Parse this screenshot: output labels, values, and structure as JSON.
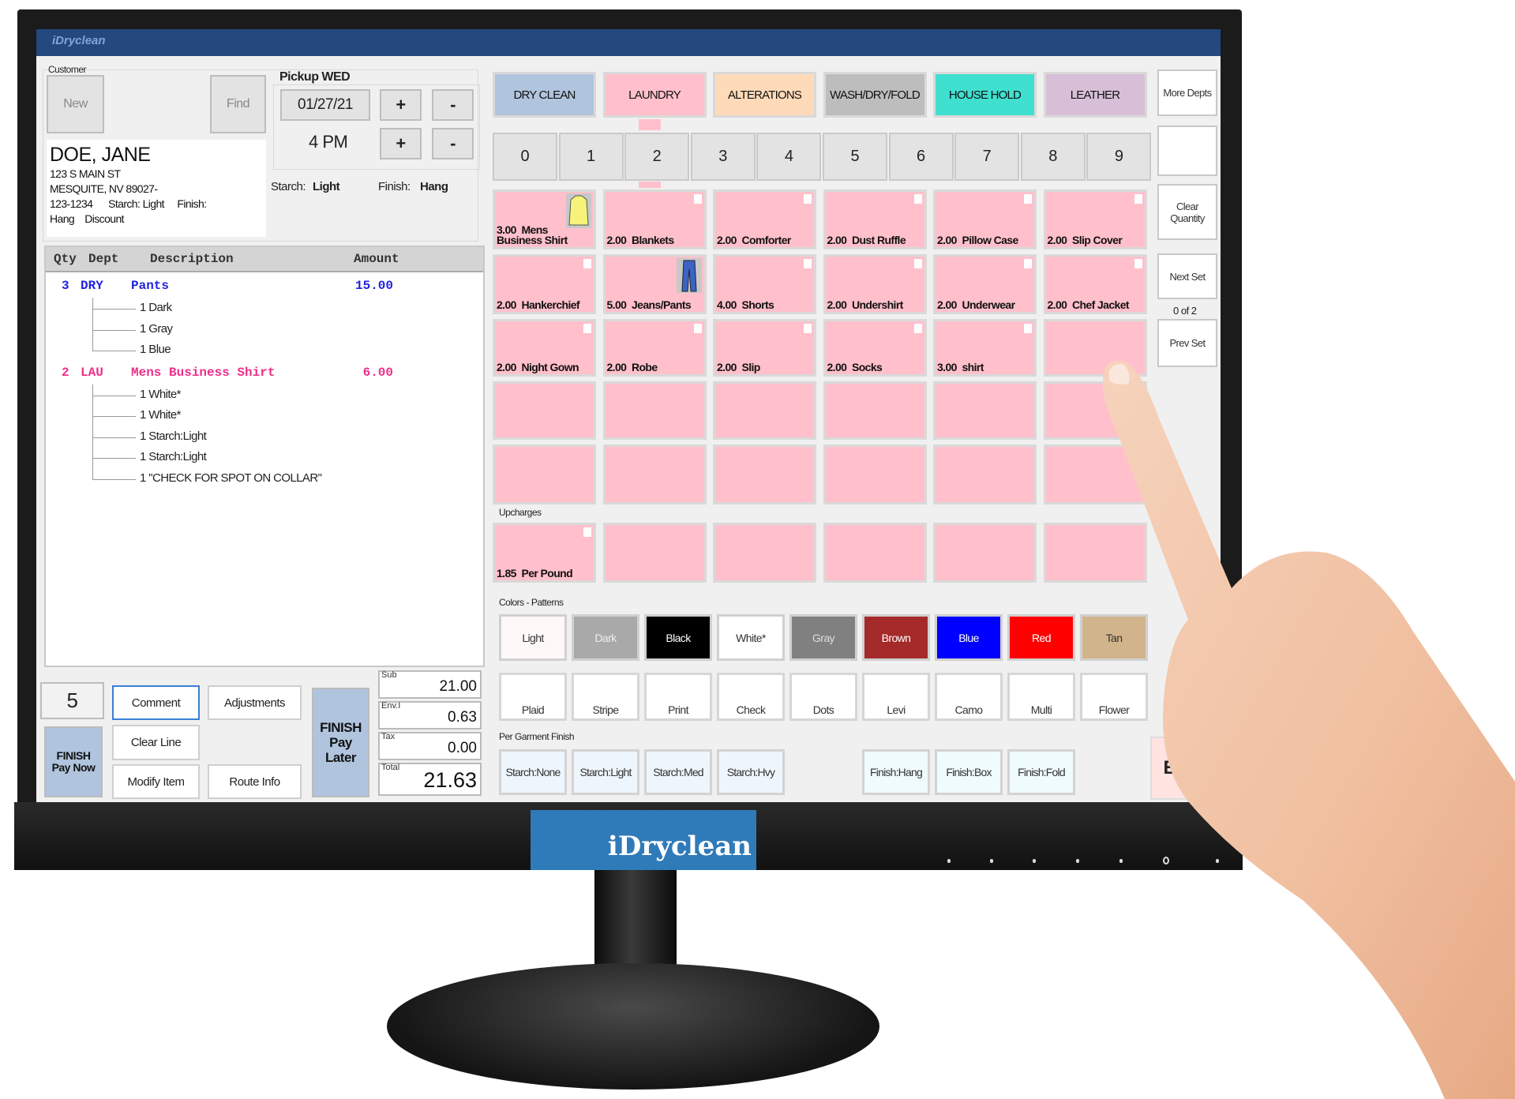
{
  "app": {
    "title_logo": "iDryclean",
    "bezel_logo": "iDryclean"
  },
  "customer": {
    "group_label": "Customer",
    "new_label": "New",
    "find_label": "Find",
    "name": "DOE, JANE",
    "address": "123 S MAIN ST",
    "city": "MESQUITE, NV  89027-",
    "phone": "123-1234",
    "starch": "Starch: Light",
    "finish": "Finish:",
    "finish2": "Hang",
    "discount": "Discount"
  },
  "pickup": {
    "label": "Pickup WED",
    "date": "01/27/21",
    "time": "4 PM",
    "plus": "+",
    "minus": "-",
    "starch_label": "Starch:",
    "starch_value": "Light",
    "finish_label": "Finish:",
    "finish_value": "Hang"
  },
  "grid": {
    "headers": {
      "qty": "Qty",
      "dept": "Dept",
      "desc": "Description",
      "amount": "Amount"
    },
    "rows": [
      {
        "qty": "3",
        "dept": "DRY",
        "desc": "Pants",
        "amount": "15.00",
        "color": "#2222dd",
        "subs": [
          "1 Dark",
          "1 Gray",
          "1 Blue"
        ]
      },
      {
        "qty": "2",
        "dept": "LAU",
        "desc": "Mens Business Shirt",
        "amount": "6.00",
        "color": "#ee2f8a",
        "subs": [
          "1 White*",
          "1 White*",
          "1 Starch:Light",
          "1 Starch:Light",
          "1 \"CHECK FOR SPOT ON COLLAR\""
        ]
      }
    ]
  },
  "actions": {
    "quantity": "5",
    "comment": "Comment",
    "adjustments": "Adjustments",
    "clear_line": "Clear Line",
    "modify_item": "Modify Item",
    "route_info": "Route Info",
    "finish_now": "FINISH\nPay Now",
    "finish_later": "FINISH\nPay\nLater"
  },
  "totals": [
    {
      "label": "Sub",
      "value": "21.00"
    },
    {
      "label": "Env.I",
      "value": "0.63"
    },
    {
      "label": "Tax",
      "value": "0.00"
    },
    {
      "label": "Total",
      "value": "21.63"
    }
  ],
  "departments": [
    {
      "label": "DRY CLEAN",
      "color": "#b0c4de"
    },
    {
      "label": "LAUNDRY",
      "color": "#ffc0cb"
    },
    {
      "label": "ALTERATIONS",
      "color": "#ffdab9"
    },
    {
      "label": "WASH/DRY/FOLD",
      "color": "#bdbdbd"
    },
    {
      "label": "HOUSE HOLD",
      "color": "#40e0d0"
    },
    {
      "label": "LEATHER",
      "color": "#d8bfd8"
    }
  ],
  "selected_department": "LAUNDRY",
  "numbers": [
    "0",
    "1",
    "2",
    "3",
    "4",
    "5",
    "6",
    "7",
    "8",
    "9"
  ],
  "selected_number": "2",
  "side": {
    "more_depts": "More Depts",
    "clear_quantity": "Clear Quantity",
    "next_set": "Next Set",
    "set_count": "0 of 2",
    "prev_set": "Prev Set"
  },
  "items": [
    {
      "price": "3.00",
      "name": "Mens\nBusiness Shirt",
      "icon": "shirt-icon"
    },
    {
      "price": "2.00",
      "name": "Blankets"
    },
    {
      "price": "2.00",
      "name": "Comforter"
    },
    {
      "price": "2.00",
      "name": "Dust Ruffle"
    },
    {
      "price": "2.00",
      "name": "Pillow Case"
    },
    {
      "price": "2.00",
      "name": "Slip Cover"
    },
    {
      "price": "2.00",
      "name": "Hankerchief"
    },
    {
      "price": "5.00",
      "name": "Jeans/Pants",
      "icon": "jeans-icon"
    },
    {
      "price": "4.00",
      "name": "Shorts"
    },
    {
      "price": "2.00",
      "name": "Undershirt"
    },
    {
      "price": "2.00",
      "name": "Underwear"
    },
    {
      "price": "2.00",
      "name": "Chef Jacket"
    },
    {
      "price": "2.00",
      "name": "Night Gown"
    },
    {
      "price": "2.00",
      "name": "Robe"
    },
    {
      "price": "2.00",
      "name": "Slip"
    },
    {
      "price": "2.00",
      "name": "Socks"
    },
    {
      "price": "3.00",
      "name": "shirt"
    },
    {},
    {},
    {},
    {},
    {},
    {},
    {},
    {},
    {},
    {},
    {},
    {},
    {}
  ],
  "upcharges": {
    "label": "Upcharges",
    "items": [
      {
        "price": "1.85",
        "name": "Per Pound"
      },
      {},
      {},
      {},
      {},
      {}
    ]
  },
  "colors": {
    "label": "Colors - Patterns",
    "items": [
      {
        "label": "Light",
        "bg": "#fff8f8",
        "fg": "#333"
      },
      {
        "label": "Dark",
        "bg": "#a9a9a9",
        "fg": "#eee"
      },
      {
        "label": "Black",
        "bg": "#000000",
        "fg": "#fff"
      },
      {
        "label": "White*",
        "bg": "#ffffff",
        "fg": "#333"
      },
      {
        "label": "Gray",
        "bg": "#808080",
        "fg": "#ddd"
      },
      {
        "label": "Brown",
        "bg": "#a52a2a",
        "fg": "#fff"
      },
      {
        "label": "Blue",
        "bg": "#0000ff",
        "fg": "#fff"
      },
      {
        "label": "Red",
        "bg": "#ff0000",
        "fg": "#fff"
      },
      {
        "label": "Tan",
        "bg": "#d2b48c",
        "fg": "#333"
      }
    ],
    "patterns": [
      "Plaid",
      "Stripe",
      "Print",
      "Check",
      "Dots",
      "Levi",
      "Camo",
      "Multi",
      "Flower"
    ]
  },
  "finish": {
    "label": "Per Garment Finish",
    "starch": [
      "Starch:None",
      "Starch:Light",
      "Starch:Med",
      "Starch:Hvy"
    ],
    "finish": [
      "Finish:Hang",
      "Finish:Box",
      "Finish:Fold"
    ],
    "exit": "Exit"
  }
}
